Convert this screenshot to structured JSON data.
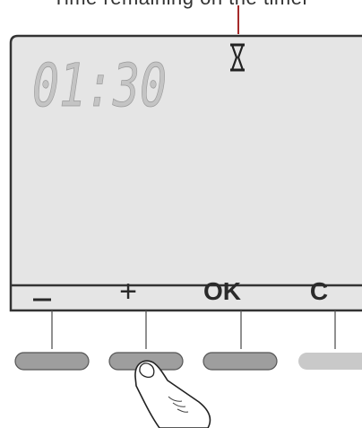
{
  "caption": "Time remaining on the timer",
  "display": {
    "time": "01:30",
    "timer_icon": "hourglass-icon"
  },
  "buttons": [
    {
      "label": "–",
      "name": "minus"
    },
    {
      "label": "+",
      "name": "plus"
    },
    {
      "label": "OK",
      "name": "ok"
    },
    {
      "label": "C",
      "name": "cancel"
    }
  ],
  "colors": {
    "lcd": "#e5e5e5",
    "frame": "#333333",
    "digits": "#c4c4c4",
    "pointer": "#a52a2a",
    "button": "#9e9e9e",
    "button_light": "#c9c9c9"
  }
}
